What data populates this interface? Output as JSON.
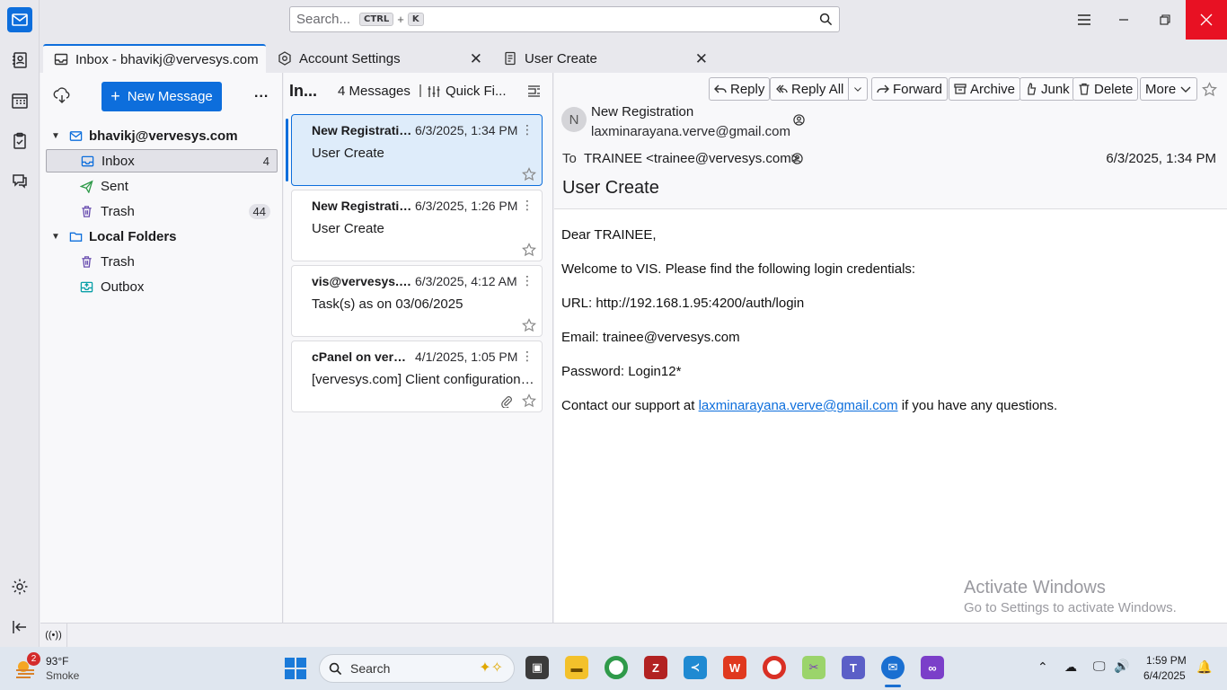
{
  "search": {
    "placeholder": "Search...",
    "shortcut_key1": "CTRL",
    "shortcut_plus": "+",
    "shortcut_key2": "K"
  },
  "tabs": [
    {
      "label": "Inbox - bhavikj@vervesys.com",
      "active": true
    },
    {
      "label": "Account Settings",
      "active": false
    },
    {
      "label": "User Create",
      "active": false
    }
  ],
  "folder_pane": {
    "new_message_label": "New Message",
    "more_label": "...",
    "account": "bhavikj@vervesys.com",
    "account_folders": [
      {
        "name": "Inbox",
        "count": "4",
        "selected": true
      },
      {
        "name": "Sent",
        "count": ""
      },
      {
        "name": "Trash",
        "count": "44"
      }
    ],
    "local_label": "Local Folders",
    "local_folders": [
      {
        "name": "Trash"
      },
      {
        "name": "Outbox"
      }
    ]
  },
  "message_list": {
    "folder_title": "In...",
    "count_label": "4 Messages",
    "quick_filter_label": "Quick Fi...",
    "messages": [
      {
        "sender": "New Registration",
        "date": "6/3/2025, 1:34 PM",
        "subject": "User Create",
        "selected": true,
        "attachment": false
      },
      {
        "sender": "New Registration",
        "date": "6/3/2025, 1:26 PM",
        "subject": "User Create",
        "selected": false,
        "attachment": false
      },
      {
        "sender": "vis@vervesys.com",
        "date": "6/3/2025, 4:12 AM",
        "subject": "Task(s) as on 03/06/2025",
        "selected": false,
        "attachment": false
      },
      {
        "sender": "cPanel on vervesys.com",
        "date": "4/1/2025, 1:05 PM",
        "subject": "[vervesys.com] Client configuration settings",
        "selected": false,
        "attachment": true
      }
    ]
  },
  "reader": {
    "buttons": {
      "reply": "Reply",
      "reply_all": "Reply All",
      "forward": "Forward",
      "archive": "Archive",
      "junk": "Junk",
      "delete": "Delete",
      "more": "More"
    },
    "avatar_initial": "N",
    "from_name": "New Registration",
    "from_email": "laxminarayana.verve@gmail.com",
    "to_label": "To",
    "to_value": "TRAINEE <trainee@vervesys.com>",
    "date": "6/3/2025, 1:34 PM",
    "subject": "User Create",
    "body": {
      "greeting": "Dear TRAINEE,",
      "welcome": "Welcome to VIS. Please find the following login credentials:",
      "url_line": "URL: http://192.168.1.95:4200/auth/login",
      "email_line": "Email: trainee@vervesys.com",
      "password_line": "Password: Login12*",
      "contact_prefix": "Contact our support at",
      "contact_link": "laxminarayana.verve@gmail.com",
      "contact_suffix": "if you have any questions."
    }
  },
  "watermark": {
    "title": "Activate Windows",
    "subtitle": "Go to Settings to activate Windows."
  },
  "taskbar": {
    "weather_badge": "2",
    "temperature": "93°F",
    "condition": "Smoke",
    "search_label": "Search",
    "time": "1:59 PM",
    "date": "6/4/2025"
  },
  "colors": {
    "accent": "#0d6edc",
    "close_red": "#e81123",
    "selected_card": "#deecfa"
  }
}
